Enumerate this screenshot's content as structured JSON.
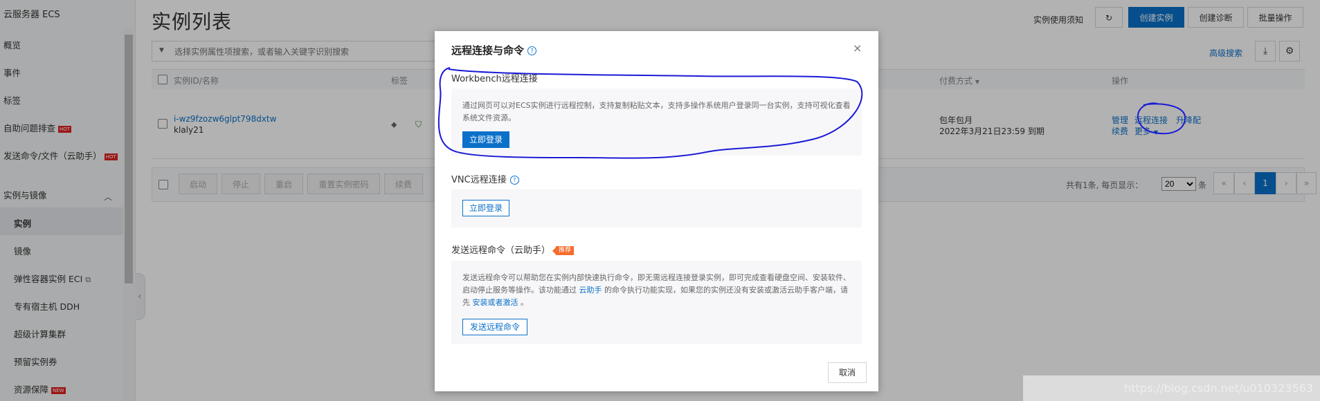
{
  "sidebar": {
    "title": "云服务器 ECS",
    "items": [
      {
        "label": "概览"
      },
      {
        "label": "事件"
      },
      {
        "label": "标签"
      },
      {
        "label": "自助问题排查",
        "badge": "HOT"
      },
      {
        "label": "发送命令/文件（云助手）",
        "badge": "HOT"
      }
    ],
    "group": {
      "label": "实例与镜像"
    },
    "sub_items": [
      {
        "label": "实例",
        "active": true
      },
      {
        "label": "镜像"
      },
      {
        "label": "弹性容器实例 ECI"
      },
      {
        "label": "专有宿主机 DDH"
      },
      {
        "label": "超级计算集群"
      },
      {
        "label": "预留实例券"
      },
      {
        "label": "资源保障",
        "badge": "NEW"
      }
    ]
  },
  "header": {
    "title": "实例列表",
    "notice_link": "实例使用须知",
    "buttons": {
      "create": "创建实例",
      "diagnose": "创建诊断",
      "batch": "批量操作"
    }
  },
  "search": {
    "placeholder": "选择实例属性项搜索，或者输入关键字识别搜索",
    "advanced": "高级搜索"
  },
  "table": {
    "columns": {
      "id": "实例ID/名称",
      "tags": "标签",
      "billing": "付费方式",
      "ops": "操作"
    },
    "row": {
      "id": "i-wz9fzozw6glpt798dxtw",
      "name": "klaly21",
      "billing_type": "包年包月",
      "expiry": "2022年3月21日23:59 到期",
      "ops": {
        "manage": "管理",
        "remote": "远程连接",
        "upgrade": "升降配",
        "renew": "续费",
        "more": "更多"
      }
    }
  },
  "footer": {
    "buttons": [
      "启动",
      "停止",
      "重启",
      "重置实例密码",
      "续费"
    ],
    "summary": "共有1条, 每页显示：",
    "page_size": "20",
    "page_size_suffix": "条",
    "pager": [
      "«",
      "‹",
      "1",
      "›",
      "»"
    ]
  },
  "modal": {
    "title": "远程连接与命令",
    "close": "×",
    "workbench": {
      "title": "Workbench远程连接",
      "desc": "通过网页可以对ECS实例进行远程控制，支持复制粘贴文本，支持多操作系统用户登录同一台实例，支持可视化查看系统文件资源。",
      "button": "立即登录"
    },
    "vnc": {
      "title": "VNC远程连接",
      "button": "立即登录"
    },
    "assistant": {
      "title": "发送远程命令（云助手）",
      "tag": "推荐",
      "desc_1": "发送远程命令可以帮助您在实例内部快速执行命令，即无需远程连接登录实例，即可完成查看硬盘空间、安装软件、启动停止服务等操作。该功能通过",
      "desc_link_1": "云助手",
      "desc_2": "的命令执行功能实现，如果您的实例还没有安装或激活云助手客户端，请先",
      "desc_link_2": "安装或者激活",
      "desc_3": "。",
      "button": "发送远程命令"
    },
    "cancel": "取消"
  },
  "watermark": "https://blog.csdn.net/u010323563",
  "colors": {
    "primary": "#0b70c9",
    "hot": "#e02020",
    "recommend": "#f56c2b",
    "annotation": "#1a1ad6"
  }
}
